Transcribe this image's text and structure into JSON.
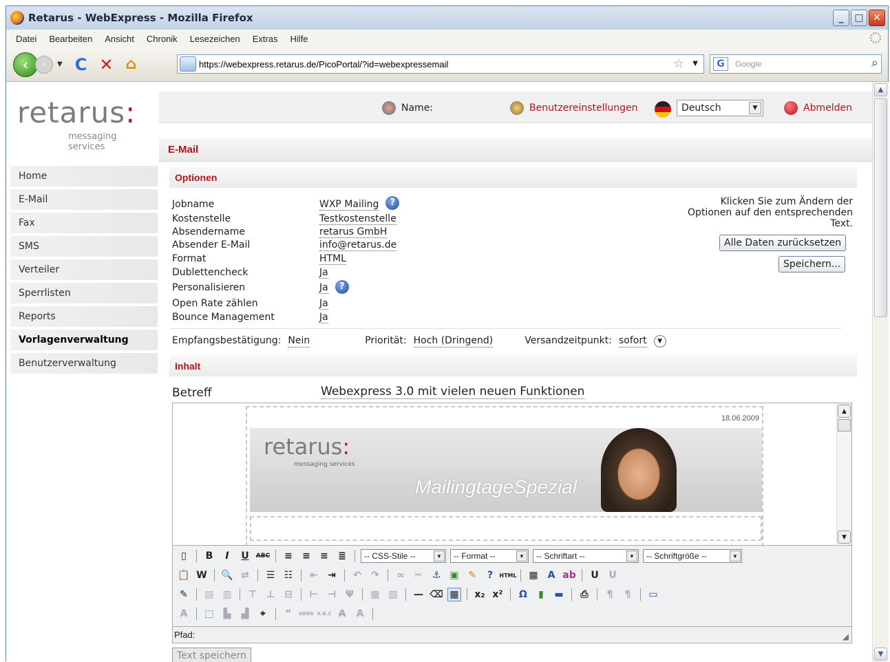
{
  "window": {
    "title": "Retarus - WebExpress - Mozilla Firefox"
  },
  "menu": [
    "Datei",
    "Bearbeiten",
    "Ansicht",
    "Chronik",
    "Lesezeichen",
    "Extras",
    "Hilfe"
  ],
  "navbar": {
    "url": "https://webexpress.retarus.de/PicoPortal/?id=webexpressemail",
    "search_placeholder": "Google"
  },
  "logo": {
    "word": "retarus",
    "tagline": "messaging services"
  },
  "top": {
    "name_label": "Name:",
    "settings": "Benutzereinstellungen",
    "language": "Deutsch",
    "logout": "Abmelden"
  },
  "sidebar": {
    "items": [
      {
        "label": "Home"
      },
      {
        "label": "E-Mail"
      },
      {
        "label": "Fax"
      },
      {
        "label": "SMS"
      },
      {
        "label": "Verteiler"
      },
      {
        "label": "Sperrlisten"
      },
      {
        "label": "Reports"
      },
      {
        "label": "Vorlagenverwaltung"
      },
      {
        "label": "Benutzerverwaltung"
      }
    ]
  },
  "main": {
    "title": "E-Mail",
    "options_head": "Optionen",
    "options": [
      {
        "label": "Jobname",
        "value": "WXP Mailing"
      },
      {
        "label": "Kostenstelle",
        "value": "Testkostenstelle"
      },
      {
        "label": "Absendername",
        "value": "retarus GmbH"
      },
      {
        "label": "Absender E-Mail",
        "value": "info@retarus.de"
      },
      {
        "label": "Format",
        "value": "HTML"
      },
      {
        "label": "Dublettencheck",
        "value": "Ja"
      },
      {
        "label": "Personalisieren",
        "value": "Ja"
      },
      {
        "label": "Open Rate zählen",
        "value": "Ja"
      },
      {
        "label": "Bounce Management",
        "value": "Ja"
      }
    ],
    "hint": "Klicken Sie zum Ändern der Optionen auf den entsprechenden Text.",
    "reset_btn": "Alle Daten zurücksetzen",
    "save_btn": "Speichern...",
    "receipt_label": "Empfangsbestätigung:",
    "receipt_value": "Nein",
    "priority_label": "Priorität:",
    "priority_value": "Hoch (Dringend)",
    "send_label": "Versandzeitpunkt:",
    "send_value": "sofort",
    "content_head": "Inhalt",
    "subject_label": "Betreff",
    "subject_value": "Webexpress 3.0 mit vielen neuen Funktionen",
    "mail": {
      "date": "18.06.2009",
      "logo": "retarus",
      "tagline": "messaging services",
      "motto": "MailingtageSpezial"
    },
    "toolbar": {
      "css_style": "-- CSS-Stile --",
      "format": "-- Format --",
      "font": "-- Schriftart --",
      "size": "-- Schriftgröße --"
    },
    "path_label": "Pfad:",
    "save_text": "Text speichern"
  }
}
